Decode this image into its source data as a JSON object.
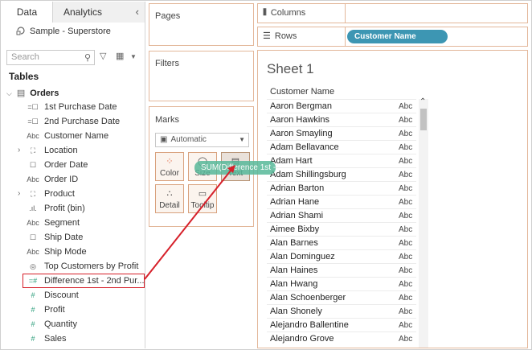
{
  "left_pane": {
    "tabs": {
      "data": "Data",
      "analytics": "Analytics",
      "collapse_icon": "‹"
    },
    "datasource": "Sample - Superstore",
    "search_placeholder": "Search",
    "tables_heading": "Tables",
    "table_name": "Orders",
    "fields": [
      {
        "label": "1st Purchase Date",
        "icon": "calendar-calc-icon",
        "glyph": "=☐",
        "type": "dimension"
      },
      {
        "label": "2nd Purchase Date",
        "icon": "calendar-calc-icon",
        "glyph": "=☐",
        "type": "dimension"
      },
      {
        "label": "Customer Name",
        "icon": "abc-icon",
        "glyph": "Abc",
        "type": "dimension"
      },
      {
        "label": "Location",
        "icon": "hierarchy-icon",
        "glyph": "⛶",
        "type": "dimension",
        "expandable": true
      },
      {
        "label": "Order Date",
        "icon": "calendar-icon",
        "glyph": "☐",
        "type": "dimension"
      },
      {
        "label": "Order ID",
        "icon": "abc-icon",
        "glyph": "Abc",
        "type": "dimension"
      },
      {
        "label": "Product",
        "icon": "hierarchy-icon",
        "glyph": "⛶",
        "type": "dimension",
        "expandable": true
      },
      {
        "label": "Profit (bin)",
        "icon": "bin-icon",
        "glyph": ".ıl.",
        "type": "dimension"
      },
      {
        "label": "Segment",
        "icon": "abc-icon",
        "glyph": "Abc",
        "type": "dimension"
      },
      {
        "label": "Ship Date",
        "icon": "calendar-icon",
        "glyph": "☐",
        "type": "dimension"
      },
      {
        "label": "Ship Mode",
        "icon": "abc-icon",
        "glyph": "Abc",
        "type": "dimension"
      },
      {
        "label": "Top Customers by Profit",
        "icon": "set-icon",
        "glyph": "◎",
        "type": "dimension"
      },
      {
        "label": "Difference 1st - 2nd Pur...",
        "icon": "calc-number-icon",
        "glyph": "=#",
        "type": "measure",
        "selected": true
      },
      {
        "label": "Discount",
        "icon": "number-icon",
        "glyph": "#",
        "type": "measure"
      },
      {
        "label": "Profit",
        "icon": "number-icon",
        "glyph": "#",
        "type": "measure"
      },
      {
        "label": "Quantity",
        "icon": "number-icon",
        "glyph": "#",
        "type": "measure"
      },
      {
        "label": "Sales",
        "icon": "number-icon",
        "glyph": "#",
        "type": "measure"
      }
    ]
  },
  "cards": {
    "pages": "Pages",
    "filters": "Filters",
    "marks": "Marks",
    "mark_type": "Automatic",
    "mark_buttons": [
      {
        "label": "Color",
        "icon": "color-dots-icon",
        "glyph": "⁘"
      },
      {
        "label": "Size",
        "icon": "size-icon",
        "glyph": "◯"
      },
      {
        "label": "Text",
        "icon": "text-icon",
        "glyph": "▤"
      },
      {
        "label": "Detail",
        "icon": "detail-icon",
        "glyph": "∴"
      },
      {
        "label": "Tooltip",
        "icon": "tooltip-icon",
        "glyph": "▭"
      }
    ]
  },
  "shelves": {
    "columns_label": "Columns",
    "rows_label": "Rows",
    "rows_pill": "Customer Name"
  },
  "view": {
    "sheet_title": "Sheet 1",
    "column_header": "Customer Name",
    "cell_value": "Abc",
    "rows": [
      "Aaron Bergman",
      "Aaron Hawkins",
      "Aaron Smayling",
      "Adam Bellavance",
      "Adam Hart",
      "Adam Shillingsburg",
      "Adrian Barton",
      "Adrian Hane",
      "Adrian Shami",
      "Aimee Bixby",
      "Alan Barnes",
      "Alan Dominguez",
      "Alan Haines",
      "Alan Hwang",
      "Alan Schoenberger",
      "Alan Shonely",
      "Alejandro Ballentine",
      "Alejandro Grove"
    ]
  },
  "drag_ghost": "SUM(Difference 1st - ...",
  "colors": {
    "pill": "#3d96b3",
    "ghost": "#58b99a",
    "highlight": "#d6202a",
    "card_border": "#e3b79a",
    "measure_icon": "#2a9d7a"
  }
}
